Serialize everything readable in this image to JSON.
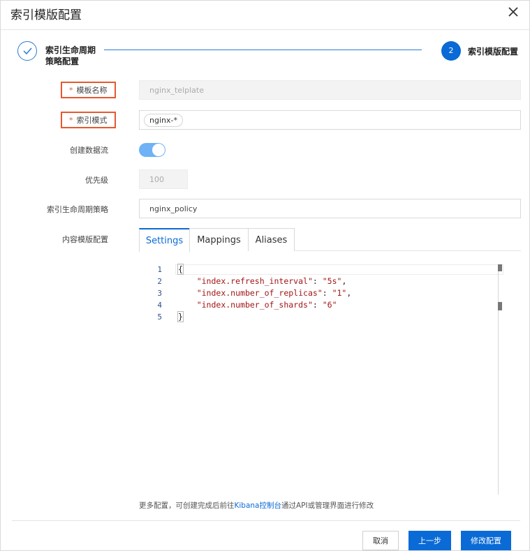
{
  "dialog": {
    "title": "索引模版配置"
  },
  "steps": [
    {
      "label": "索引生命周期策略配置",
      "status": "done"
    },
    {
      "number": "2",
      "label": "索引模版配置",
      "status": "active"
    }
  ],
  "form": {
    "template_name": {
      "required_mark": "*",
      "label": "模板名称",
      "value": "nginx_telplate"
    },
    "index_pattern": {
      "required_mark": "*",
      "label": "索引模式",
      "tag": "nginx-*"
    },
    "create_data_stream": {
      "label": "创建数据流",
      "enabled": true
    },
    "priority": {
      "label": "优先级",
      "value": "100"
    },
    "lifecycle_policy": {
      "label": "索引生命周期策略",
      "value": "nginx_policy"
    },
    "content_config": {
      "label": "内容模版配置"
    }
  },
  "tabs": [
    {
      "label": "Settings",
      "active": true
    },
    {
      "label": "Mappings",
      "active": false
    },
    {
      "label": "Aliases",
      "active": false
    }
  ],
  "editor": {
    "line_numbers": [
      "1",
      "2",
      "3",
      "4",
      "5"
    ],
    "lines": {
      "open": "{",
      "l2_key": "\"index.refresh_interval\"",
      "l2_val": "\"5s\"",
      "l3_key": "\"index.number_of_replicas\"",
      "l3_val": "\"1\"",
      "l4_key": "\"index.number_of_shards\"",
      "l4_val": "\"6\"",
      "close": "}"
    }
  },
  "hint": {
    "before": "更多配置，可创建完成后前往",
    "link": "Kibana控制台",
    "after": "通过API或管理界面进行修改"
  },
  "footer": {
    "cancel": "取消",
    "prev": "上一步",
    "submit": "修改配置"
  },
  "colors": {
    "primary": "#0a6ad6",
    "highlight": "#e8572e",
    "toggle_on": "#6fb2f5"
  }
}
